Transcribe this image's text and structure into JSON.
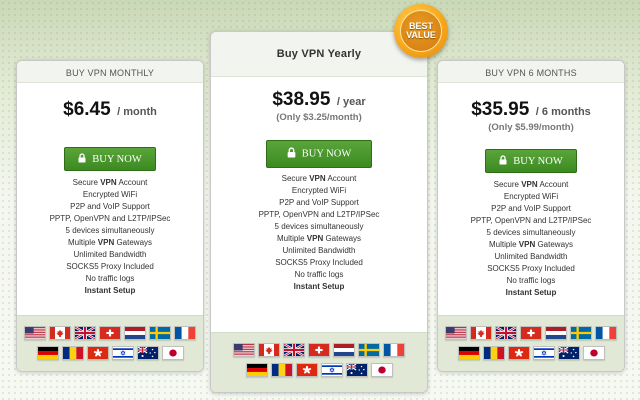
{
  "badge": {
    "line1": "BEST",
    "line2": "VALUE"
  },
  "plans": [
    {
      "title": "BUY VPN MONTHLY",
      "price": "$6.45",
      "period": "/ month",
      "subprice": "",
      "button": "BUY NOW"
    },
    {
      "title": "Buy VPN Yearly",
      "price": "$38.95",
      "period": "/ year",
      "subprice": "(Only $3.25/month)",
      "button": "BUY NOW"
    },
    {
      "title": "BUY VPN 6 MONTHS",
      "price": "$35.95",
      "period": "/ 6 months",
      "subprice": "(Only $5.99/month)",
      "button": "BUY NOW"
    }
  ],
  "features": [
    {
      "pre": "Secure ",
      "bold": "VPN",
      "post": " Account"
    },
    {
      "pre": "Encrypted WiFi",
      "bold": "",
      "post": ""
    },
    {
      "pre": "P2P and VoIP Support",
      "bold": "",
      "post": ""
    },
    {
      "pre": "PPTP, OpenVPN and L2TP/IPSec",
      "bold": "",
      "post": ""
    },
    {
      "pre": "5 devices simultaneously",
      "bold": "",
      "post": ""
    },
    {
      "pre": "Multiple ",
      "bold": "VPN",
      "post": " Gateways"
    },
    {
      "pre": "Unlimited Bandwidth",
      "bold": "",
      "post": ""
    },
    {
      "pre": "SOCKS5 Proxy Included",
      "bold": "",
      "post": ""
    },
    {
      "pre": "No traffic logs",
      "bold": "",
      "post": ""
    },
    {
      "pre": "",
      "bold": "Instant Setup",
      "post": ""
    }
  ],
  "flags": {
    "row1": [
      "usa-flag",
      "canada-flag",
      "uk-flag",
      "switzerland-flag",
      "netherlands-flag",
      "sweden-flag",
      "france-flag"
    ],
    "row2": [
      "germany-flag",
      "romania-flag",
      "hong-kong-flag",
      "israel-flag",
      "australia-flag",
      "japan-flag"
    ]
  },
  "colors": {
    "button_green": "#3b8a21",
    "badge_orange": "#f7a81c",
    "flags_background": "#e1e9d6"
  }
}
